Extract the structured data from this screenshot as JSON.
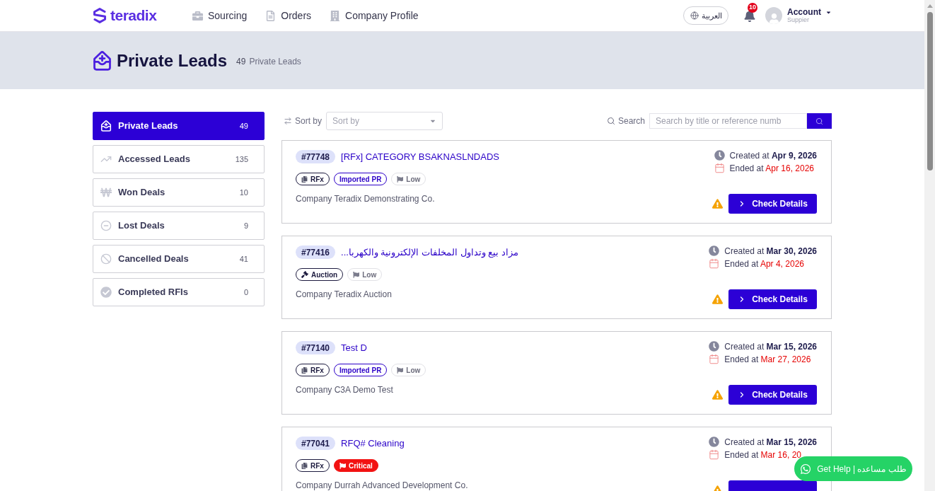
{
  "navbar": {
    "logo": "teradix",
    "links": [
      {
        "label": "Sourcing"
      },
      {
        "label": "Orders"
      },
      {
        "label": "Company Profile"
      }
    ],
    "language": "العربية",
    "notification_count": "10",
    "account": {
      "name": "Account",
      "role": "Suppier"
    }
  },
  "header": {
    "title": "Private Leads",
    "count": "49",
    "count_label": "Private Leads"
  },
  "sidebar": {
    "items": [
      {
        "label": "Private Leads",
        "count": "49",
        "selected": true
      },
      {
        "label": "Accessed Leads",
        "count": "135",
        "selected": false
      },
      {
        "label": "Won Deals",
        "count": "10",
        "selected": false
      },
      {
        "label": "Lost Deals",
        "count": "9",
        "selected": false
      },
      {
        "label": "Cancelled Deals",
        "count": "41",
        "selected": false
      },
      {
        "label": "Completed RFIs",
        "count": "0",
        "selected": false
      }
    ]
  },
  "toolbar": {
    "sort_label": "Sort by",
    "sort_placeholder": "Sort by",
    "search_label": "Search",
    "search_placeholder": "Search by title or reference numb"
  },
  "leads": [
    {
      "ref": "#77748",
      "title": "[RFx] CATEGORY BSAKNASLNDADS",
      "tags": [
        {
          "kind": "rfx",
          "label": "RFx"
        },
        {
          "kind": "imported",
          "label": "Imported PR"
        },
        {
          "kind": "low",
          "label": "Low"
        }
      ],
      "company": "Company Teradix Demonstrating Co.",
      "created_label": "Created at",
      "created": "Apr 9, 2026",
      "ended_label": "Ended at",
      "ended": "Apr 16, 2026",
      "warning": true,
      "action": "Check Details"
    },
    {
      "ref": "#77416",
      "title": "مزاد بيع وتداول المخلفات الإلكترونية والكهربا...",
      "tags": [
        {
          "kind": "auction",
          "label": "Auction"
        },
        {
          "kind": "low",
          "label": "Low"
        }
      ],
      "company": "Company Teradix Auction",
      "created_label": "Created at",
      "created": "Mar 30, 2026",
      "ended_label": "Ended at",
      "ended": "Apr 4, 2026",
      "warning": true,
      "action": "Check Details"
    },
    {
      "ref": "#77140",
      "title": "Test D",
      "tags": [
        {
          "kind": "rfx",
          "label": "RFx"
        },
        {
          "kind": "imported",
          "label": "Imported PR"
        },
        {
          "kind": "low",
          "label": "Low"
        }
      ],
      "company": "Company C3A Demo Test",
      "created_label": "Created at",
      "created": "Mar 15, 2026",
      "ended_label": "Ended at",
      "ended": "Mar 27, 2026",
      "warning": true,
      "action": "Check Details"
    },
    {
      "ref": "#77041",
      "title": "RFQ# Cleaning",
      "tags": [
        {
          "kind": "rfx",
          "label": "RFx"
        },
        {
          "kind": "critical",
          "label": "Critical"
        }
      ],
      "company": "Company Durrah Advanced Development Co.",
      "created_label": "Created at",
      "created": "Mar 15, 2026",
      "ended_label": "Ended at",
      "ended": "Mar 16, 20",
      "warning": true
    }
  ],
  "help_button": {
    "label": "Get Help | طلب مساعده"
  }
}
